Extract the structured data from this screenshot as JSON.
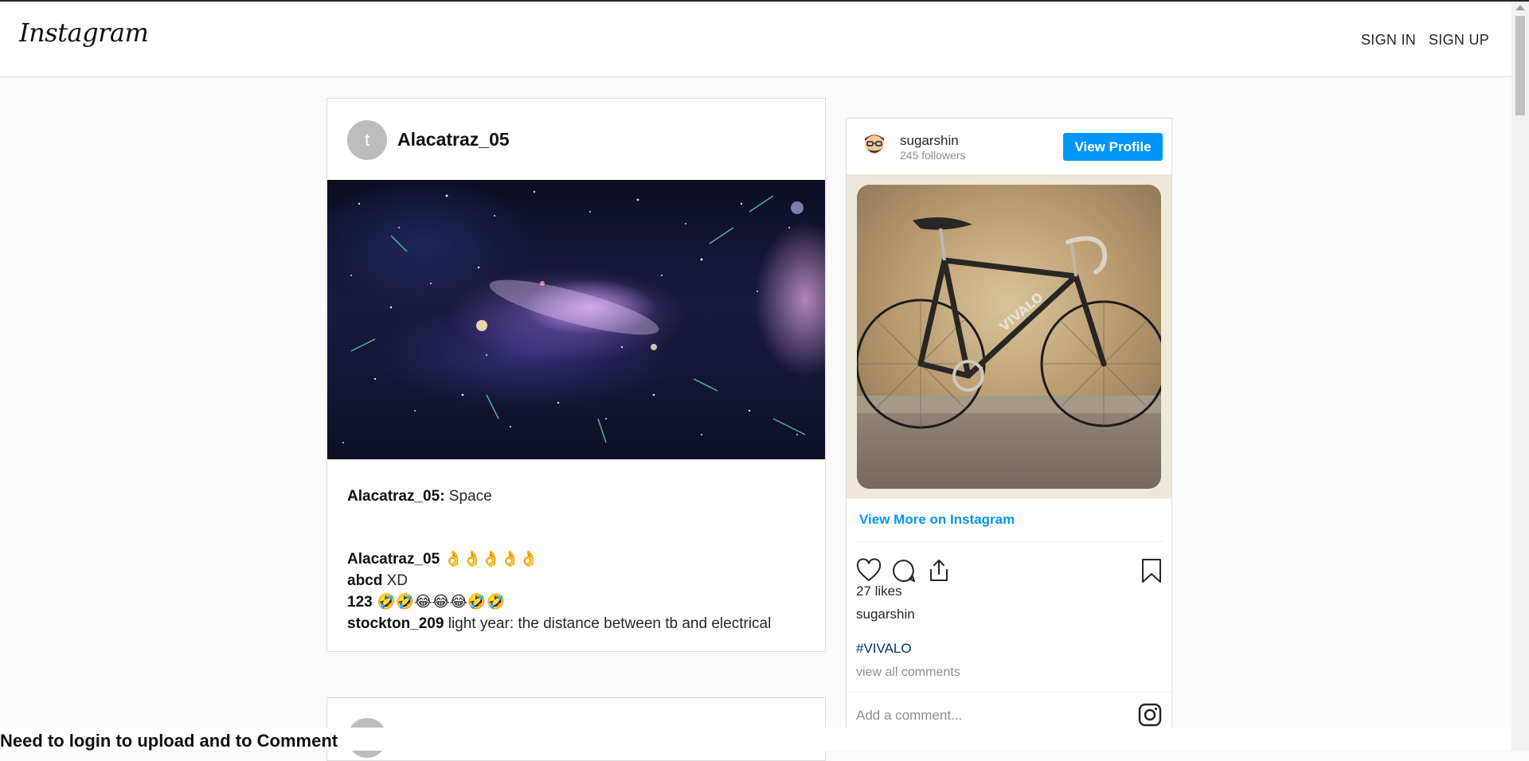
{
  "header": {
    "logo": "Instagram",
    "sign_in": "SIGN IN",
    "sign_up": "SIGN UP"
  },
  "post": {
    "avatar_letter": "t",
    "username": "Alacatraz_05",
    "caption_user": "Alacatraz_05:",
    "caption_text": " Space",
    "comments": [
      {
        "user": "Alacatraz_05",
        "text": " 👌👌👌👌👌"
      },
      {
        "user": "abcd",
        "text": " XD"
      },
      {
        "user": "123",
        "text": " 🤣🤣😂😂😂🤣🤣"
      },
      {
        "user": "stockton_209",
        "text": " light year: the distance between tb and electrical"
      }
    ]
  },
  "embed": {
    "username": "sugarshin",
    "followers": "245 followers",
    "view_profile": "View Profile",
    "view_more": "View More on Instagram",
    "likes": "27 likes",
    "likes_user": "sugarshin",
    "hashtag": "#VIVALO",
    "view_all_comments": "view all comments",
    "add_comment_placeholder": "Add a comment...",
    "photo_text": "VIVALO"
  },
  "footer": {
    "message": "Need to login to upload and to Comment"
  },
  "colors": {
    "accent": "#0095f6",
    "hashtag": "#00376b",
    "muted": "#8e8e8e"
  },
  "icons": [
    "heart-icon",
    "comment-icon",
    "share-icon",
    "bookmark-icon",
    "instagram-icon"
  ]
}
